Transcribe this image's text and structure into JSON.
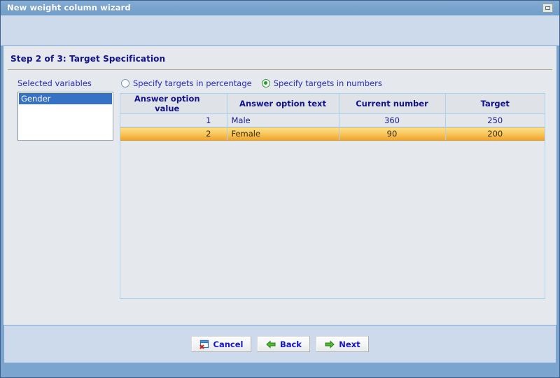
{
  "window": {
    "title": "New weight column wizard",
    "restore_icon": "restore-icon"
  },
  "step": {
    "title": "Step 2 of 3: Target Specification"
  },
  "left_panel": {
    "label": "Selected variables",
    "items": [
      {
        "label": "Gender",
        "selected": true
      }
    ]
  },
  "mode_options": [
    {
      "label": "Specify targets in percentage",
      "checked": false
    },
    {
      "label": "Specify targets in numbers",
      "checked": true
    }
  ],
  "table": {
    "columns": [
      "Answer option value",
      "Answer option text",
      "Current number",
      "Target"
    ],
    "rows": [
      {
        "value": "1",
        "text": "Male",
        "current": "360",
        "target": "250",
        "selected": false
      },
      {
        "value": "2",
        "text": "Female",
        "current": "90",
        "target": "200",
        "selected": true
      }
    ]
  },
  "buttons": {
    "cancel": {
      "label": "Cancel",
      "icon": "cancel-window-icon"
    },
    "back": {
      "label": "Back",
      "icon": "arrow-left-icon"
    },
    "next": {
      "label": "Next",
      "icon": "arrow-right-icon"
    }
  },
  "colors": {
    "titlebar": "#79a3cc",
    "accent_text": "#12128c",
    "selection_blue": "#3572c6",
    "row_highlight": "#f0a22a",
    "radio_green": "#1aa41a"
  }
}
